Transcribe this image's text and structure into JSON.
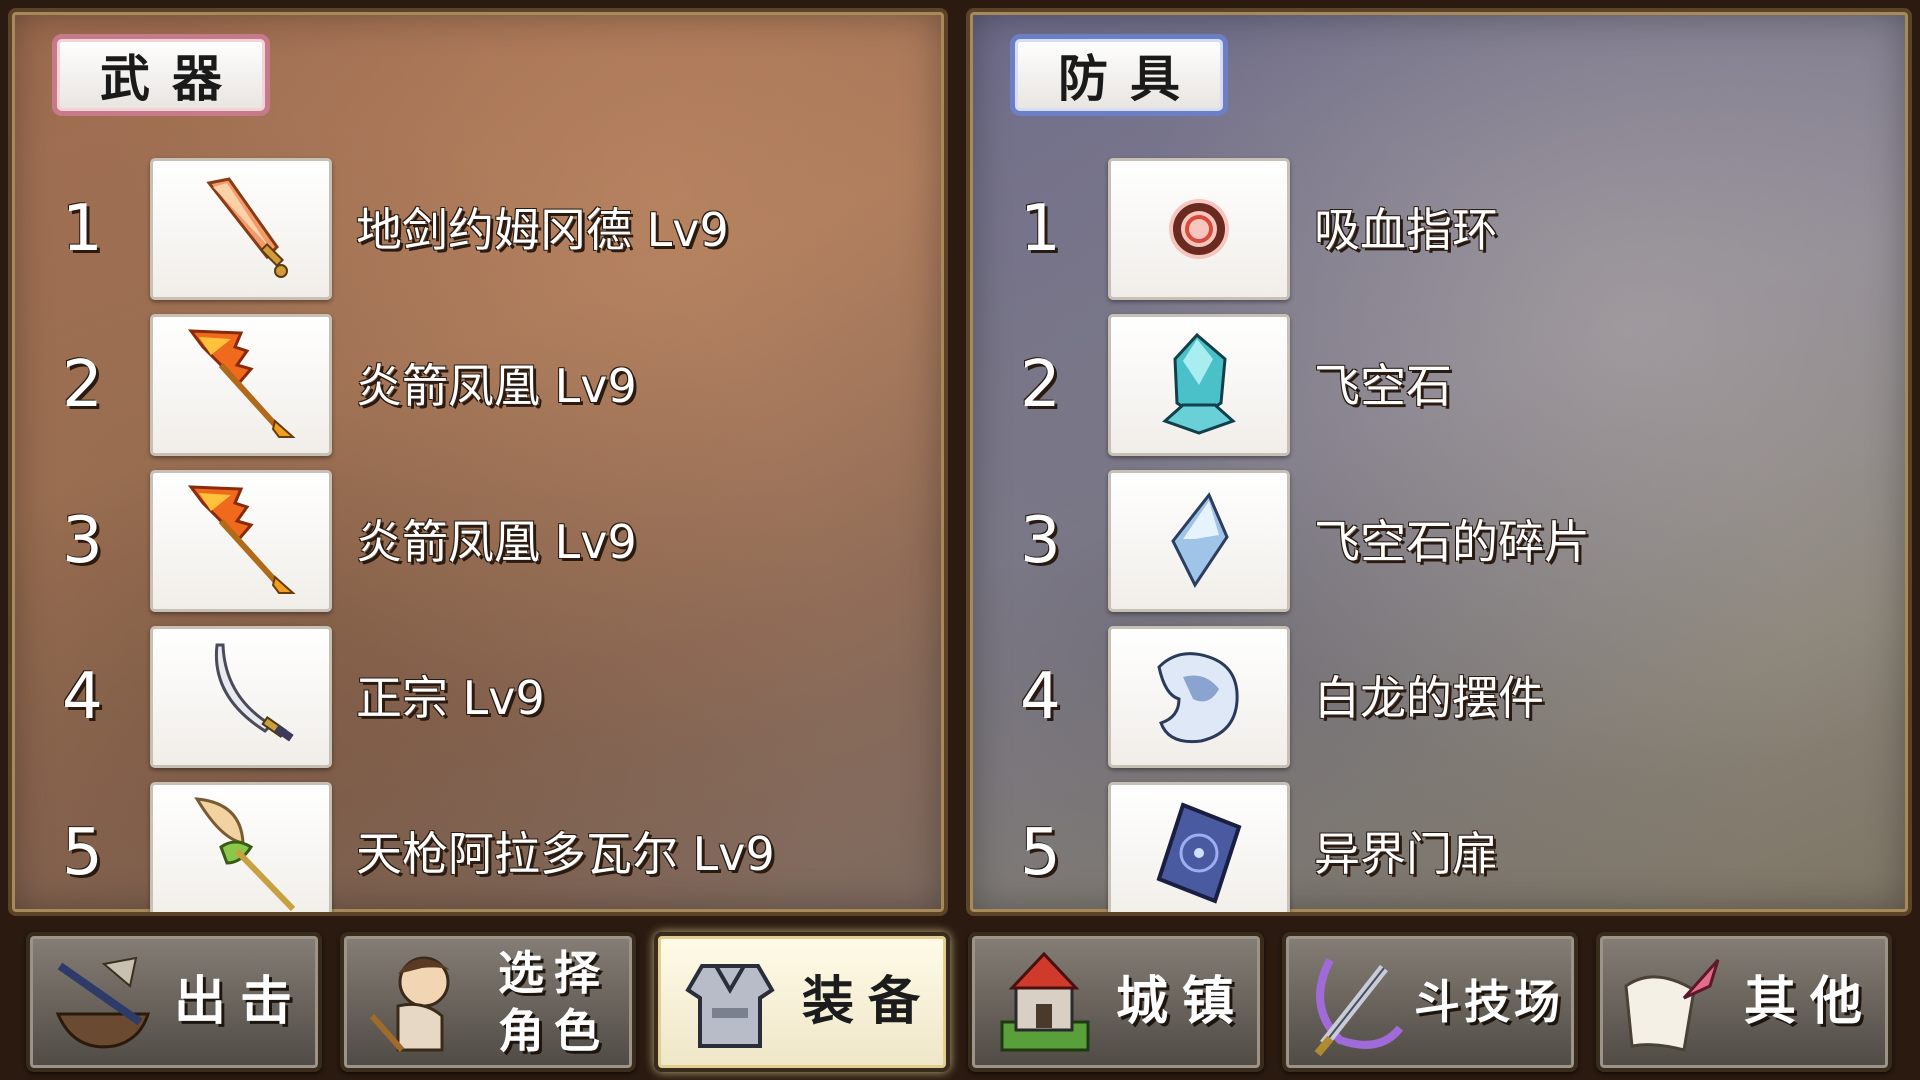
{
  "weapon_panel": {
    "title": "武器",
    "items": [
      {
        "rank": "1",
        "name": "地剑约姆冈德 Lv9",
        "icon": "earth-sword-icon"
      },
      {
        "rank": "2",
        "name": "炎箭凤凰 Lv9",
        "icon": "flame-arrow-icon"
      },
      {
        "rank": "3",
        "name": "炎箭凤凰 Lv9",
        "icon": "flame-arrow-icon"
      },
      {
        "rank": "4",
        "name": "正宗 Lv9",
        "icon": "katana-icon"
      },
      {
        "rank": "5",
        "name": "天枪阿拉多瓦尔 Lv9",
        "icon": "spear-icon"
      }
    ]
  },
  "armor_panel": {
    "title": "防具",
    "items": [
      {
        "rank": "1",
        "name": "吸血指环",
        "icon": "ring-icon"
      },
      {
        "rank": "2",
        "name": "飞空石",
        "icon": "levistone-icon"
      },
      {
        "rank": "3",
        "name": "飞空石的碎片",
        "icon": "crystal-shard-icon"
      },
      {
        "rank": "4",
        "name": "白龙的摆件",
        "icon": "dragon-figurine-icon"
      },
      {
        "rank": "5",
        "name": "异界门扉",
        "icon": "portal-door-icon"
      }
    ]
  },
  "nav": {
    "sortie": "出击",
    "select_character_line1": "选择",
    "select_character_line2": "角色",
    "equipment": "装备",
    "town": "城镇",
    "arena": "斗技场",
    "other": "其他",
    "active": "equipment"
  }
}
